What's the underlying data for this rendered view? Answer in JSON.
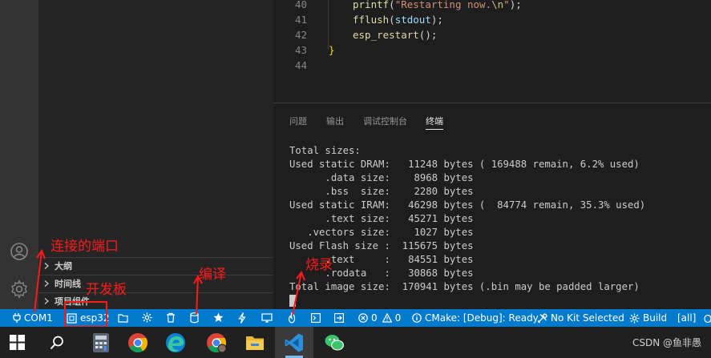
{
  "editor": {
    "lines": [
      {
        "num": "40",
        "parts": [
          [
            "fn",
            "printf"
          ],
          [
            "punc",
            "("
          ],
          [
            "str",
            "\"Restarting now."
          ],
          [
            "esc",
            "\\n"
          ],
          [
            "str",
            "\""
          ],
          [
            "punc",
            ");"
          ]
        ]
      },
      {
        "num": "41",
        "parts": [
          [
            "fn",
            "fflush"
          ],
          [
            "punc",
            "("
          ],
          [
            "var",
            "stdout"
          ],
          [
            "punc",
            ");"
          ]
        ]
      },
      {
        "num": "42",
        "parts": [
          [
            "fn",
            "esp_restart"
          ],
          [
            "punc",
            "();"
          ]
        ]
      },
      {
        "num": "43",
        "parts": [
          [
            "brace",
            "}"
          ]
        ]
      },
      {
        "num": "44",
        "parts": []
      }
    ]
  },
  "panel": {
    "tabs": [
      "问题",
      "输出",
      "调试控制台",
      "终端"
    ],
    "active_tab": "终端",
    "terminal_lines": [
      "Total sizes:",
      "Used static DRAM:   11248 bytes ( 169488 remain, 6.2% used)",
      "      .data size:    8968 bytes",
      "      .bss  size:    2280 bytes",
      "Used static IRAM:   46298 bytes (  84774 remain, 35.3% used)",
      "      .text size:   45271 bytes",
      "   .vectors size:    1027 bytes",
      "Used Flash size :  115675 bytes",
      "      .text     :   84551 bytes",
      "      .rodata   :   30868 bytes",
      "Total image size:  170941 bytes (.bin may be padded larger)"
    ]
  },
  "sidebar": {
    "sections": [
      "大纲",
      "时间线",
      "项目组件"
    ]
  },
  "status": {
    "port": "COM1",
    "target": "esp32",
    "errors": "0",
    "warnings": "0",
    "cmake": "CMake: [Debug]: Ready",
    "kit": "No Kit Selected",
    "build": "Build",
    "all": "[all]"
  },
  "annotations": {
    "port": "连接的端口",
    "board": "开发板",
    "compile": "编译",
    "flash": "烧录"
  },
  "taskbar": {
    "watermark": "CSDN @鱼非愚"
  },
  "colors": {
    "status_bar": "#007acc",
    "annotation": "#ff1a1a",
    "taskbar": "#202020"
  }
}
